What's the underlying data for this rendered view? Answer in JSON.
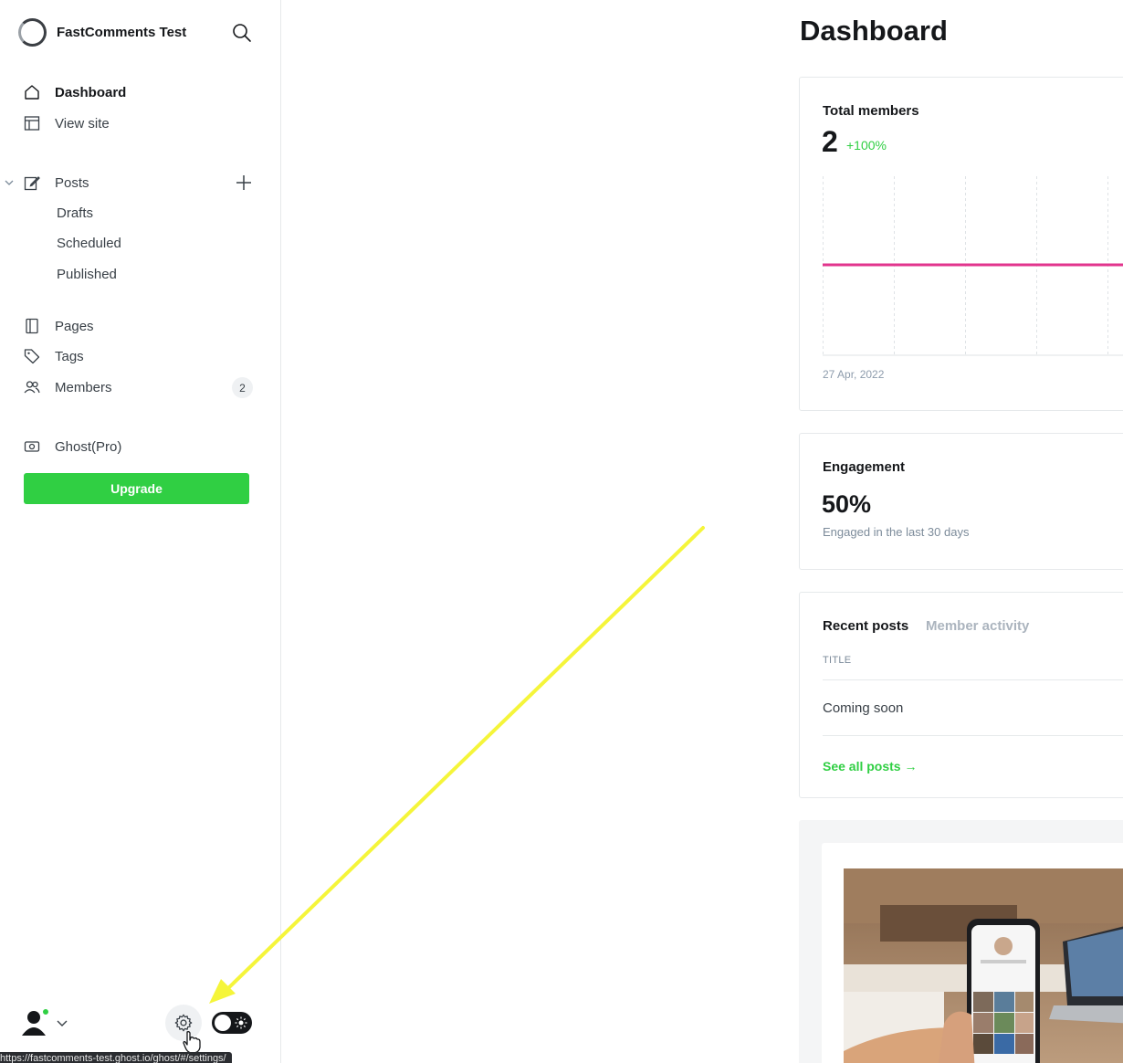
{
  "brand": {
    "name": "FastComments Test"
  },
  "nav": {
    "dashboard": "Dashboard",
    "view_site": "View site",
    "posts": "Posts",
    "drafts": "Drafts",
    "scheduled": "Scheduled",
    "published": "Published",
    "pages": "Pages",
    "tags": "Tags",
    "members": "Members",
    "members_count": "2",
    "ghost_pro": "Ghost(Pro)",
    "upgrade": "Upgrade"
  },
  "footer": {
    "status_url": "https://fastcomments-test.ghost.io/ghost/#/settings/"
  },
  "main": {
    "title": "Dashboard",
    "total_members": {
      "label": "Total members",
      "value": "2",
      "delta": "+100%",
      "date": "27 Apr, 2022"
    },
    "engagement": {
      "label": "Engagement",
      "value": "50%",
      "subtext": "Engaged in the last 30 days"
    },
    "recent": {
      "tab_active": "Recent posts",
      "tab_inactive": "Member activity",
      "column": "TITLE",
      "post_title": "Coming soon",
      "see_all": "See all posts →"
    }
  },
  "colors": {
    "accent": "#30cf43",
    "chart_line": "#e2358d",
    "annotation": "#f5f53a"
  },
  "chart_data": {
    "type": "line",
    "x": [
      "27 Apr, 2022"
    ],
    "series": [
      {
        "values": [
          2
        ]
      }
    ]
  }
}
